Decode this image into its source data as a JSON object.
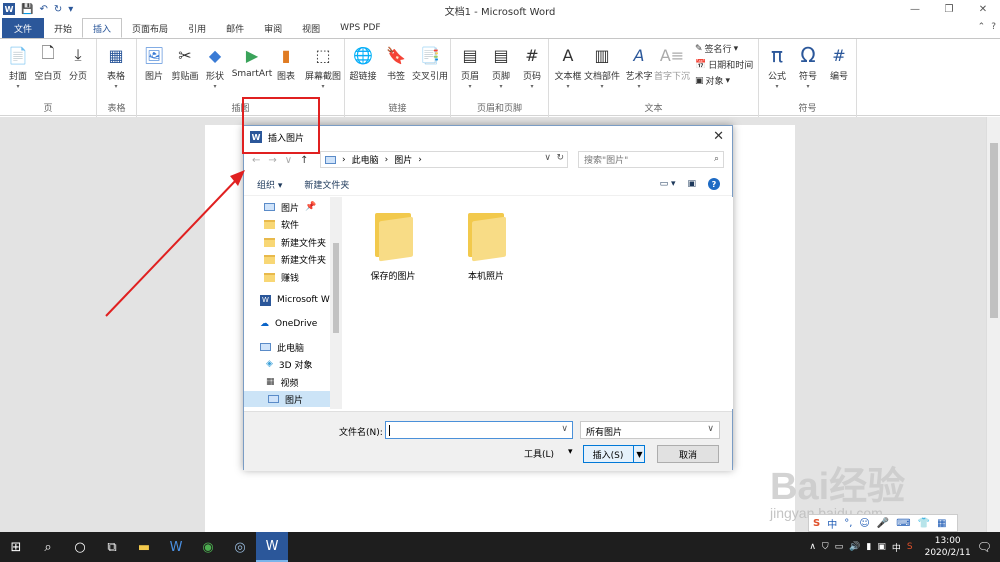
{
  "window": {
    "title": "文档1 - Microsoft Word",
    "minimize": "—",
    "restore": "❐",
    "close": "✕"
  },
  "tabs": [
    "文件",
    "开始",
    "插入",
    "页面布局",
    "引用",
    "邮件",
    "审阅",
    "视图",
    "WPS PDF"
  ],
  "ribbon": {
    "groups": {
      "page": "页",
      "table": "表格",
      "illustrations": "插图",
      "links": "链接",
      "header_footer": "页眉和页脚",
      "text": "文本",
      "symbols": "符号"
    },
    "buttons": {
      "cover": "封面",
      "blank": "空白页",
      "break": "分页",
      "table": "表格",
      "picture": "图片",
      "clipart": "剪贴画",
      "shapes": "形状",
      "smartart": "SmartArt",
      "chart": "图表",
      "screenshot": "屏幕截图",
      "hyperlink": "超链接",
      "bookmark": "书签",
      "crossref": "交叉引用",
      "header": "页眉",
      "footer": "页脚",
      "pagenum": "页码",
      "textbox": "文本框",
      "quickparts": "文档部件",
      "wordart": "艺术字",
      "dropcap": "首字下沉",
      "signature": "签名行",
      "datetime": "日期和时间",
      "object": "对象",
      "equation": "公式",
      "symbol": "符号",
      "number": "编号"
    }
  },
  "dialog": {
    "title": "插入图片",
    "breadcrumb": [
      "此电脑",
      "图片"
    ],
    "search_placeholder": "搜索\"图片\"",
    "organize": "组织",
    "new_folder": "新建文件夹",
    "nav_items": [
      "图片",
      "软件",
      "新建文件夹",
      "新建文件夹",
      "赚钱",
      "Microsoft W",
      "OneDrive",
      "此电脑",
      "3D 对象",
      "视频",
      "图片"
    ],
    "folders": [
      "保存的图片",
      "本机照片"
    ],
    "filename_label": "文件名(N):",
    "filename_value": "",
    "filter": "所有图片",
    "tools": "工具(L)",
    "insert": "插入(S)",
    "cancel": "取消"
  },
  "taskbar": {
    "time": "13:00",
    "date": "2020/2/11",
    "ime": "中"
  },
  "watermark": {
    "brand": "Bai经验",
    "url": "jingyan.baidu.com"
  },
  "colors": {
    "word_blue": "#2b579a",
    "highlight_red": "#e02020",
    "taskbar": "#1e1e1e"
  }
}
